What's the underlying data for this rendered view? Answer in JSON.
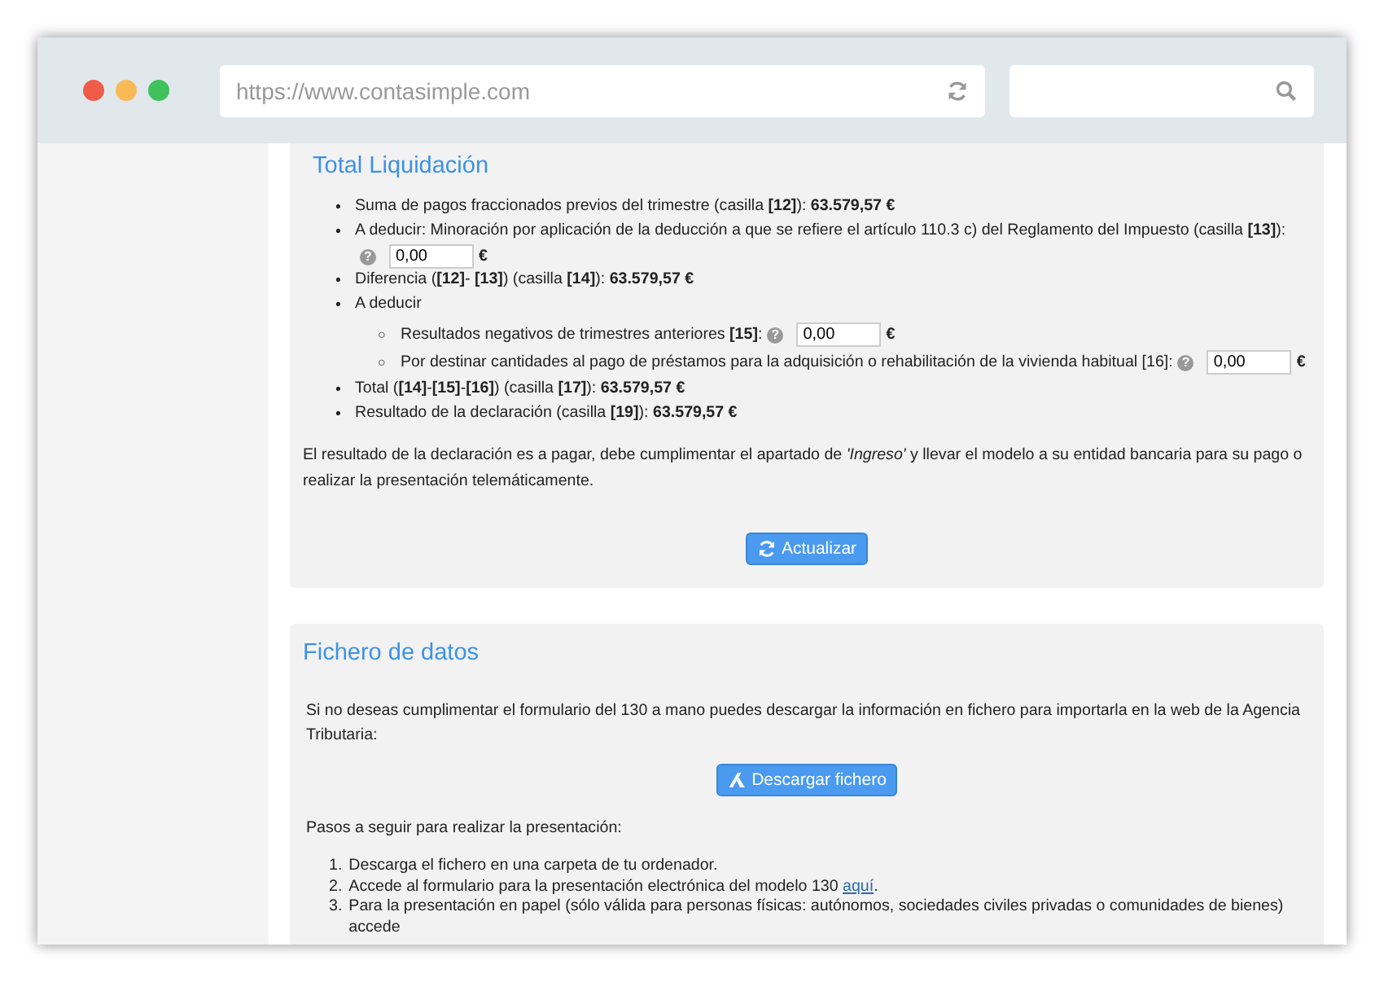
{
  "browser": {
    "url": "https://www.contasimple.com"
  },
  "liquidacion": {
    "title": "Total Liquidación",
    "items": [
      {
        "kind": "text",
        "marker": "•",
        "text": "Suma de pagos fraccionados previos del trimestre (casilla **[12]**): **63.579,57 €**"
      },
      {
        "kind": "input",
        "marker": "•",
        "text": "A deducir: Minoración por aplicación de la deducción a que se refiere el artículo 110.3 c) del Reglamento del Impuesto (casilla **[13]**):",
        "help": "?",
        "value": "0,00",
        "unit": "€"
      },
      {
        "kind": "text",
        "marker": "•",
        "text": "Diferencia (**[12]**- **[13]**) (casilla **[14]**): **63.579,57 €**"
      },
      {
        "kind": "group",
        "marker": "•",
        "text": "A deducir",
        "children": [
          {
            "kind": "input",
            "marker": "○",
            "text": "Resultados negativos de trimestres anteriores **[15]**:",
            "help": "?",
            "value": "0,00",
            "unit": "€"
          },
          {
            "kind": "input",
            "marker": "○",
            "text": "Por destinar cantidades al pago de préstamos para la adquisición o rehabilitación de la vivienda habitual [16]:",
            "help": "?",
            "value": "0,00",
            "unit": "€"
          }
        ]
      },
      {
        "kind": "text",
        "marker": "•",
        "text": "Total (**[14]**-**[15]**-**[16]**) (casilla **[17]**): **63.579,57 €**"
      },
      {
        "kind": "text",
        "marker": "•",
        "text": "Resultado de la declaración (casilla **[19]**): **63.579,57 €**"
      }
    ],
    "note": "El resultado de la declaración es a pagar, debe cumplimentar el apartado de *'Ingreso'* y llevar el modelo a su entidad bancaria para su pago o realizar la presentación telemáticamente.",
    "button": "Actualizar"
  },
  "fichero": {
    "title": "Fichero de datos",
    "intro": "Si no deseas cumplimentar el formulario del 130 a mano puedes descargar la información en fichero para importarla en la web de la Agencia Tributaria:",
    "button": "Descargar fichero",
    "steps_title": "Pasos a seguir para realizar la presentación:",
    "steps": [
      {
        "number": "1.",
        "text": "Descarga el fichero en una carpeta de tu ordenador."
      },
      {
        "number": "2.",
        "text": "Accede al formulario para la presentación electrónica del modelo 130 ",
        "link": "aquí",
        "after": "."
      },
      {
        "number": "3.",
        "text": "Para la presentación en papel (sólo válida para personas físicas: autónomos, sociedades civiles privadas o comunidades de bienes) accede"
      }
    ]
  }
}
